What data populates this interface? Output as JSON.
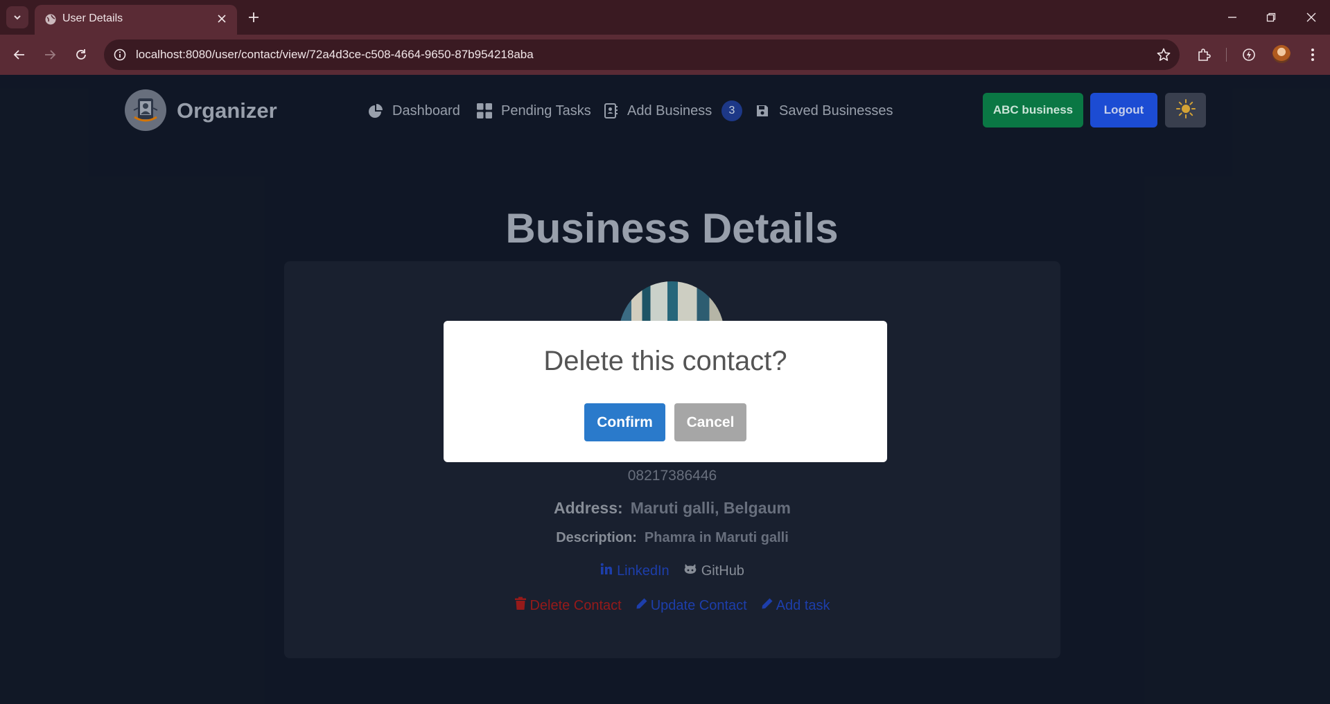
{
  "browser": {
    "tab_title": "User Details",
    "url": "localhost:8080/user/contact/view/72a4d3ce-c508-4664-9650-87b954218aba"
  },
  "header": {
    "brand": "Organizer",
    "nav": {
      "dashboard": "Dashboard",
      "pending_tasks": "Pending Tasks",
      "add_business": "Add Business",
      "add_business_badge": "3",
      "saved_businesses": "Saved Businesses"
    },
    "business_button": "ABC business",
    "logout_button": "Logout"
  },
  "main": {
    "title": "Business Details",
    "phone": "08217386446",
    "address_label": "Address:",
    "address_value": "Maruti galli, Belgaum",
    "description_label": "Description:",
    "description_value": "Phamra in Maruti galli",
    "linkedin": "LinkedIn",
    "github": "GitHub",
    "delete_contact": "Delete Contact",
    "update_contact": "Update Contact",
    "add_task": "Add task"
  },
  "modal": {
    "title": "Delete this contact?",
    "confirm": "Confirm",
    "cancel": "Cancel"
  },
  "colors": {
    "page_bg": "#111827",
    "card_bg": "#1a2130",
    "business_green": "#0b7a46",
    "logout_blue": "#1d4ed8",
    "delete_red": "#991b1b",
    "confirm_blue": "#2a7acb",
    "cancel_gray": "#a6a6a6"
  },
  "icons": [
    "tab-search-icon",
    "globe-icon",
    "close-icon",
    "plus-icon",
    "minimize-icon",
    "restore-icon",
    "back-icon",
    "forward-icon",
    "reload-icon",
    "site-info-icon",
    "star-icon",
    "extensions-icon",
    "performance-icon",
    "kebab-menu-icon",
    "pie-chart-icon",
    "grid-icon",
    "address-book-icon",
    "save-icon",
    "sun-icon",
    "linkedin-icon",
    "github-icon",
    "trash-icon",
    "pencil-icon"
  ]
}
